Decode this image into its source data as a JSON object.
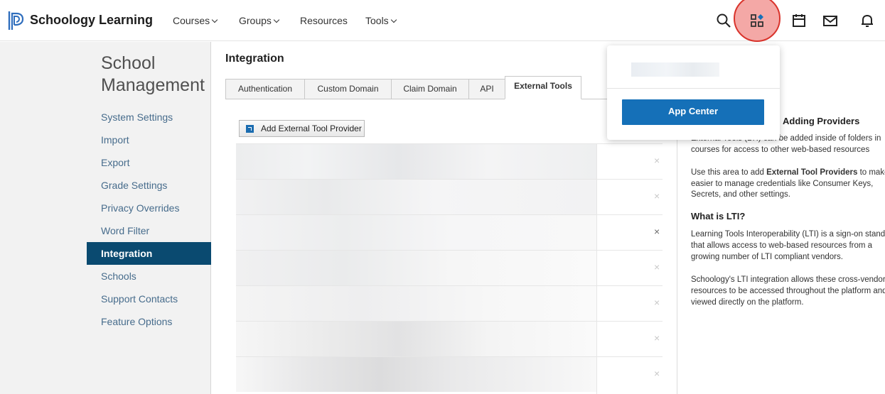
{
  "header": {
    "brand": "Schoology Learning",
    "nav": [
      {
        "label": "Courses",
        "dropdown": true
      },
      {
        "label": "Groups",
        "dropdown": true
      },
      {
        "label": "Resources",
        "dropdown": false
      },
      {
        "label": "Tools",
        "dropdown": true
      }
    ],
    "icons": [
      "search-icon",
      "apps-icon",
      "calendar-icon",
      "mail-icon",
      "bell-icon"
    ],
    "accent": "#1570b8",
    "highlight": "#d9342c"
  },
  "sidebar": {
    "title_line1": "School",
    "title_line2": "Management",
    "items": [
      {
        "label": "System Settings"
      },
      {
        "label": "Import"
      },
      {
        "label": "Export"
      },
      {
        "label": "Grade Settings"
      },
      {
        "label": "Privacy Overrides"
      },
      {
        "label": "Word Filter"
      },
      {
        "label": "Integration",
        "active": true
      },
      {
        "label": "Schools"
      },
      {
        "label": "Support Contacts"
      },
      {
        "label": "Feature Options"
      }
    ]
  },
  "main": {
    "title": "Integration",
    "tabs": [
      {
        "label": "Authentication"
      },
      {
        "label": "Custom Domain"
      },
      {
        "label": "Claim Domain"
      },
      {
        "label": "API"
      },
      {
        "label": "External Tools",
        "active": true
      }
    ],
    "add_button": "Add External Tool Provider",
    "remove_symbol": "×"
  },
  "help": {
    "heading1": "Adding Providers",
    "p1_line1": "External Tools (LTI) can be added inside of folders in",
    "p1_line2": "courses for access to other web-based resources",
    "p2_pre": "Use this area to add ",
    "p2_bold": "External Tool Providers",
    "p2_post": " to make it",
    "p2_line2": "easier to manage credentials like Consumer Keys,",
    "p2_line3": "Secrets, and other settings.",
    "heading2": "What is LTI?",
    "p3_line1": "Learning Tools Interoperability (LTI) is a sign-on standard",
    "p3_line2": "that allows access to web-based resources from a",
    "p3_line3": "growing number of LTI compliant vendors.",
    "p4_line1": "Schoology's LTI integration allows these cross-vendor",
    "p4_line2": "resources to be accessed throughout the platform and",
    "p4_line3": "viewed directly on the platform."
  },
  "dropdown": {
    "button": "App Center"
  }
}
